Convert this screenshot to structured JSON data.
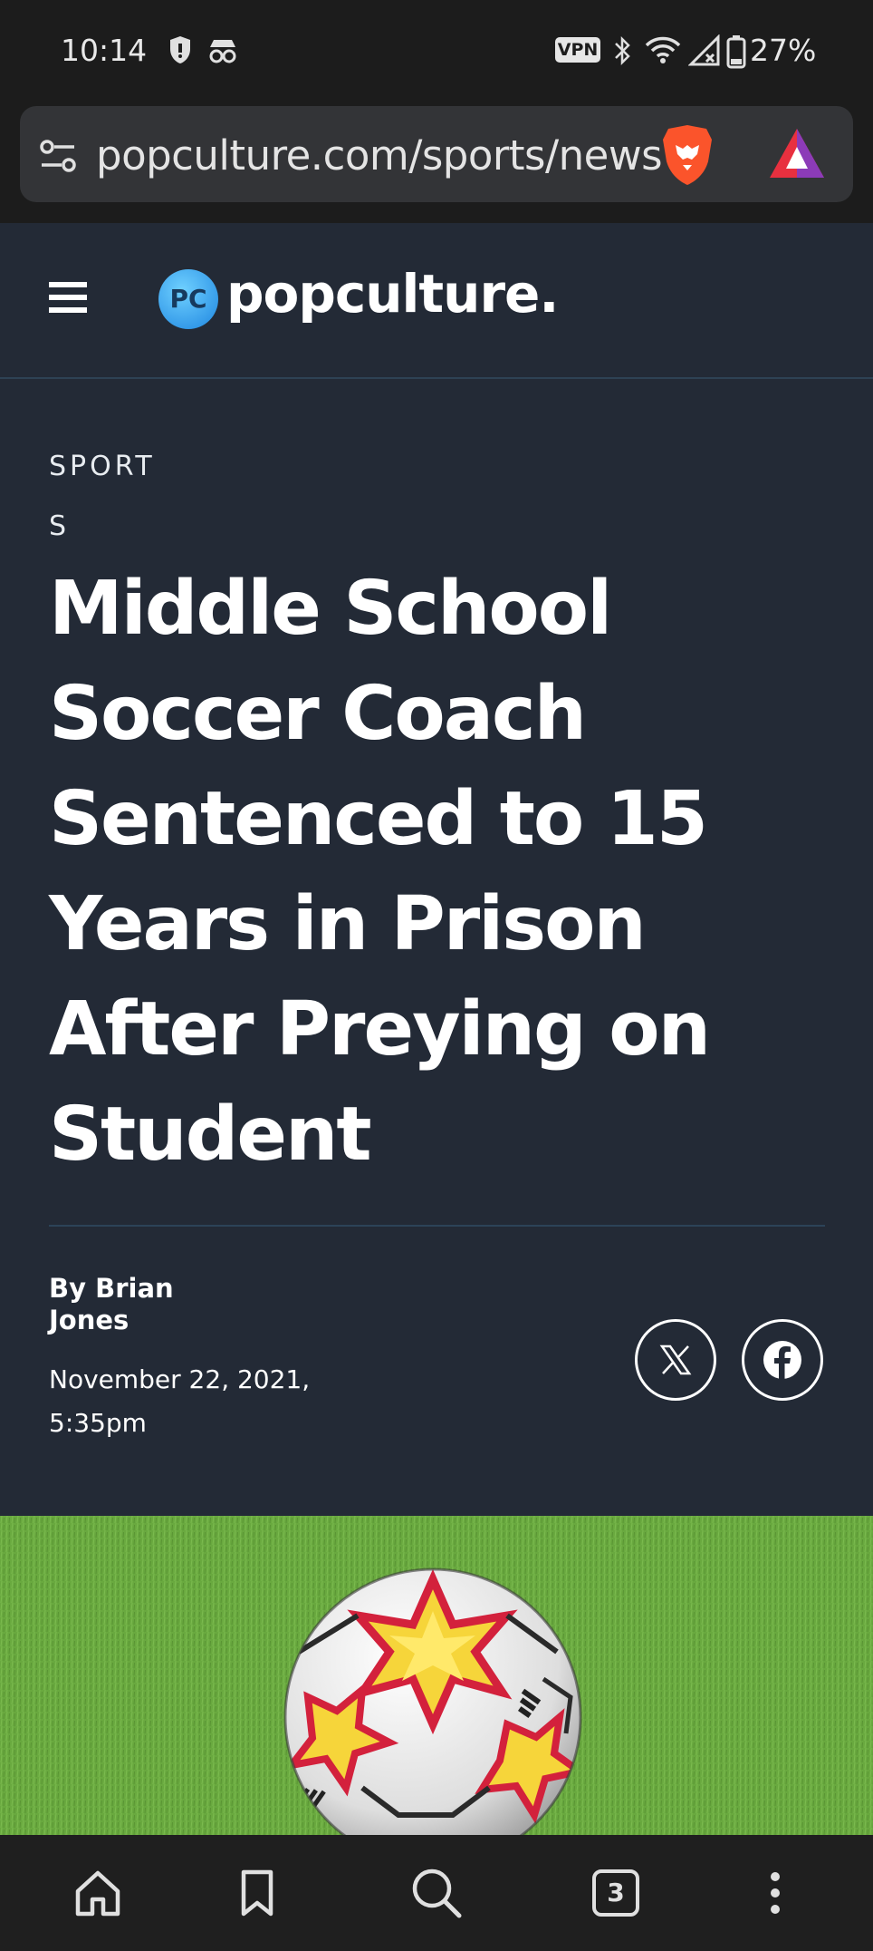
{
  "status_bar": {
    "time": "10:14",
    "vpn_label": "VPN",
    "battery_percent": "27%",
    "icons": [
      "shield-icon",
      "incognito-icon",
      "bluetooth-icon",
      "wifi-icon",
      "signal-icon",
      "battery-icon"
    ]
  },
  "browser": {
    "url": "popculture.com/sports/news",
    "tab_count": "3",
    "icons": [
      "site-settings-icon",
      "brave-shields-icon",
      "brave-rewards-icon"
    ]
  },
  "site": {
    "logo_mark": "PC",
    "logo_text": "popculture."
  },
  "article": {
    "category": "SPORTS",
    "headline": "Middle School Soccer Coach Sentenced to 15 Years in Prison After Preying on Student",
    "author": "By Brian Jones",
    "date": "November 22, 2021, 5:35pm"
  },
  "bottom_nav": {
    "items": [
      "home-icon",
      "bookmark-icon",
      "search-icon",
      "tabs-icon",
      "more-icon"
    ]
  },
  "colors": {
    "page_bg": "#232a36",
    "chrome_bg": "#1c1c1c",
    "url_box": "#333437",
    "divider": "#2c4358",
    "brave_orange": "#fb542b"
  }
}
